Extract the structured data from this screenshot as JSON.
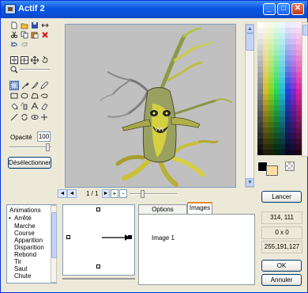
{
  "window": {
    "title": "Actif 2"
  },
  "title_buttons": {
    "minimize": "_",
    "maximize": "□",
    "close": "✕"
  },
  "opacity": {
    "label": "Opacité",
    "value": "100",
    "level_percent": 100
  },
  "deselect_button": "Désélectionner",
  "frame_nav": {
    "counter": "1 / 1",
    "add": "+",
    "remove": "-"
  },
  "launch_button": "Lancer",
  "animations": {
    "header": "Animations",
    "items": [
      "Arrêté",
      "Marche",
      "Course",
      "Apparition",
      "Disparition",
      "Rebond",
      "Tir",
      "Saut",
      "Chute"
    ],
    "selected_marker": "•"
  },
  "tabs": [
    {
      "label": "Options Direction"
    },
    {
      "label": "Images"
    }
  ],
  "tab_content": {
    "image_label": "Image 1"
  },
  "readouts": {
    "coords": "314, 111",
    "size": "0 x 0",
    "color": "255,191,127"
  },
  "buttons": {
    "ok": "OK",
    "cancel": "Annuler"
  },
  "colors": {
    "title_bar": "#0a55e0",
    "selected_fg": "#000000",
    "selected_bg": "#ffdfa0"
  }
}
